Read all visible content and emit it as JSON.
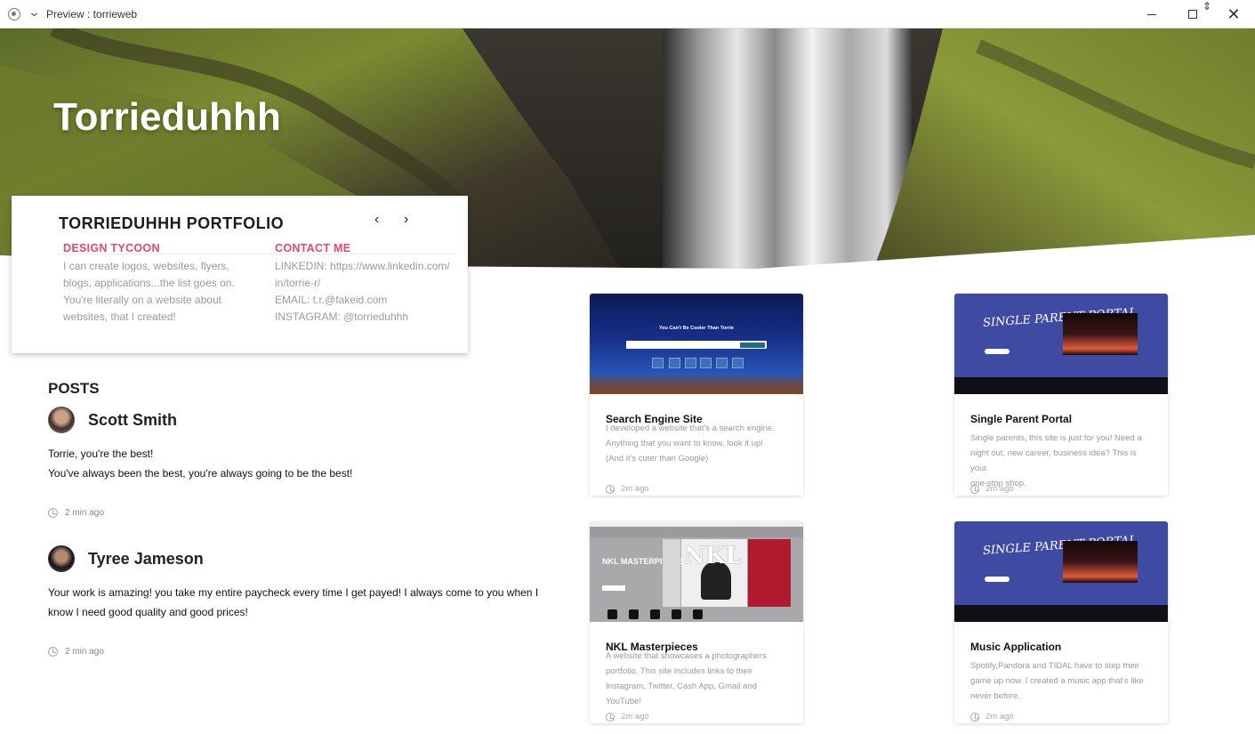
{
  "window": {
    "title": "Preview : torrieweb"
  },
  "hero": {
    "title": "Torrieduhhh"
  },
  "portfolio": {
    "title": "TORRIEDUHHH  PORTFOLIO",
    "prev_icon": "‹",
    "next_icon": "›",
    "design": {
      "heading": "DESIGN TYCOON",
      "lines": [
        "I can create logos, websites, flyers,",
        "blogs, applications...the list goes on.",
        "You're literally on a website about",
        "websites, that I created!"
      ]
    },
    "contact": {
      "heading": "CONTACT ME",
      "lines": [
        "LINKEDIN: https://www.linkedin.com/",
        "in/torrie-r/",
        "EMAIL: t.r.@fakeid.com",
        "INSTAGRAM: @torrieduhhh"
      ]
    }
  },
  "posts": {
    "heading": "POSTS",
    "items": [
      {
        "name": "Scott Smith",
        "lines": [
          "Torrie, you're the best!",
          "You've always been the best, you're always going to be the best!"
        ],
        "time": "2 min ago"
      },
      {
        "name": "Tyree Jameson",
        "lines": [
          "Your work is amazing! you take my entire paycheck every time I get payed! I always come to you when I",
          "know I need good quality and good prices!"
        ],
        "time": "2 min ago"
      }
    ]
  },
  "projects": [
    {
      "title": "Search Engine Site",
      "lines": [
        "I developed a website that's a search engine.",
        "Anything that you want to know, look it up!",
        "(And it's cuter than Google)"
      ],
      "time": "2m ago",
      "thumb_text": "You Can't Be Cooler Than Torrie"
    },
    {
      "title": "Single Parent Portal",
      "lines": [
        "Single parents, this site is just for you! Need a",
        "night out, new career, business idea? This is your",
        "one-stop shop."
      ],
      "time": "2m ago",
      "thumb_text": "SINGLE PARENT PORTAL"
    },
    {
      "title": "NKL Masterpieces",
      "lines": [
        "A website that showcases a photographers",
        "portfolio. This site includes links to their",
        "Instagram, Twitter, Cash App, Gmail and",
        "YouTube!"
      ],
      "time": "2m ago",
      "thumb_text": "NKL MASTERPIECES",
      "thumb_logo": "NKL"
    },
    {
      "title": "Music Application",
      "lines": [
        "Spotify,Pandora and TIDAL have to step their",
        "game up now. I created a music app that's like",
        "never before."
      ],
      "time": "2m ago",
      "thumb_text": "SINGLE PARENT PORTAL"
    }
  ]
}
